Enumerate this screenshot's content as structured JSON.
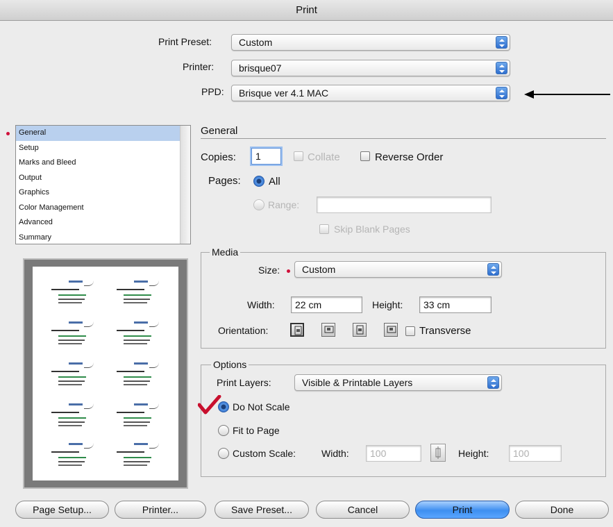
{
  "window": {
    "title": "Print"
  },
  "top": {
    "preset_label": "Print Preset:",
    "preset_value": "Custom",
    "printer_label": "Printer:",
    "printer_value": "brisque07",
    "ppd_label": "PPD:",
    "ppd_value": "Brisque ver 4.1 MAC"
  },
  "sidebar": {
    "items": [
      "General",
      "Setup",
      "Marks and Bleed",
      "Output",
      "Graphics",
      "Color Management",
      "Advanced",
      "Summary"
    ],
    "selected": "General"
  },
  "general": {
    "heading": "General",
    "copies_label": "Copies:",
    "copies_value": "1",
    "collate_label": "Collate",
    "reverse_label": "Reverse Order",
    "pages_label": "Pages:",
    "all_label": "All",
    "range_label": "Range:",
    "range_value": "",
    "skip_label": "Skip Blank Pages"
  },
  "media": {
    "heading": "Media",
    "size_label": "Size:",
    "size_value": "Custom",
    "width_label": "Width:",
    "width_value": "22 cm",
    "height_label": "Height:",
    "height_value": "33 cm",
    "orientation_label": "Orientation:",
    "transverse_label": "Transverse"
  },
  "options": {
    "heading": "Options",
    "layers_label": "Print Layers:",
    "layers_value": "Visible & Printable Layers",
    "noscale_label": "Do Not Scale",
    "fit_label": "Fit to Page",
    "custom_label": "Custom Scale:",
    "scale_width_label": "Width:",
    "scale_width_value": "100",
    "scale_height_label": "Height:",
    "scale_height_value": "100"
  },
  "buttons": {
    "page_setup": "Page Setup...",
    "printer": "Printer...",
    "save_preset": "Save Preset...",
    "cancel": "Cancel",
    "print": "Print",
    "done": "Done"
  },
  "colors": {
    "accent": "#3e8ff0",
    "selection": "#b9d0ee",
    "checkmark": "#c8102e",
    "required_dot": "#d0103a"
  }
}
